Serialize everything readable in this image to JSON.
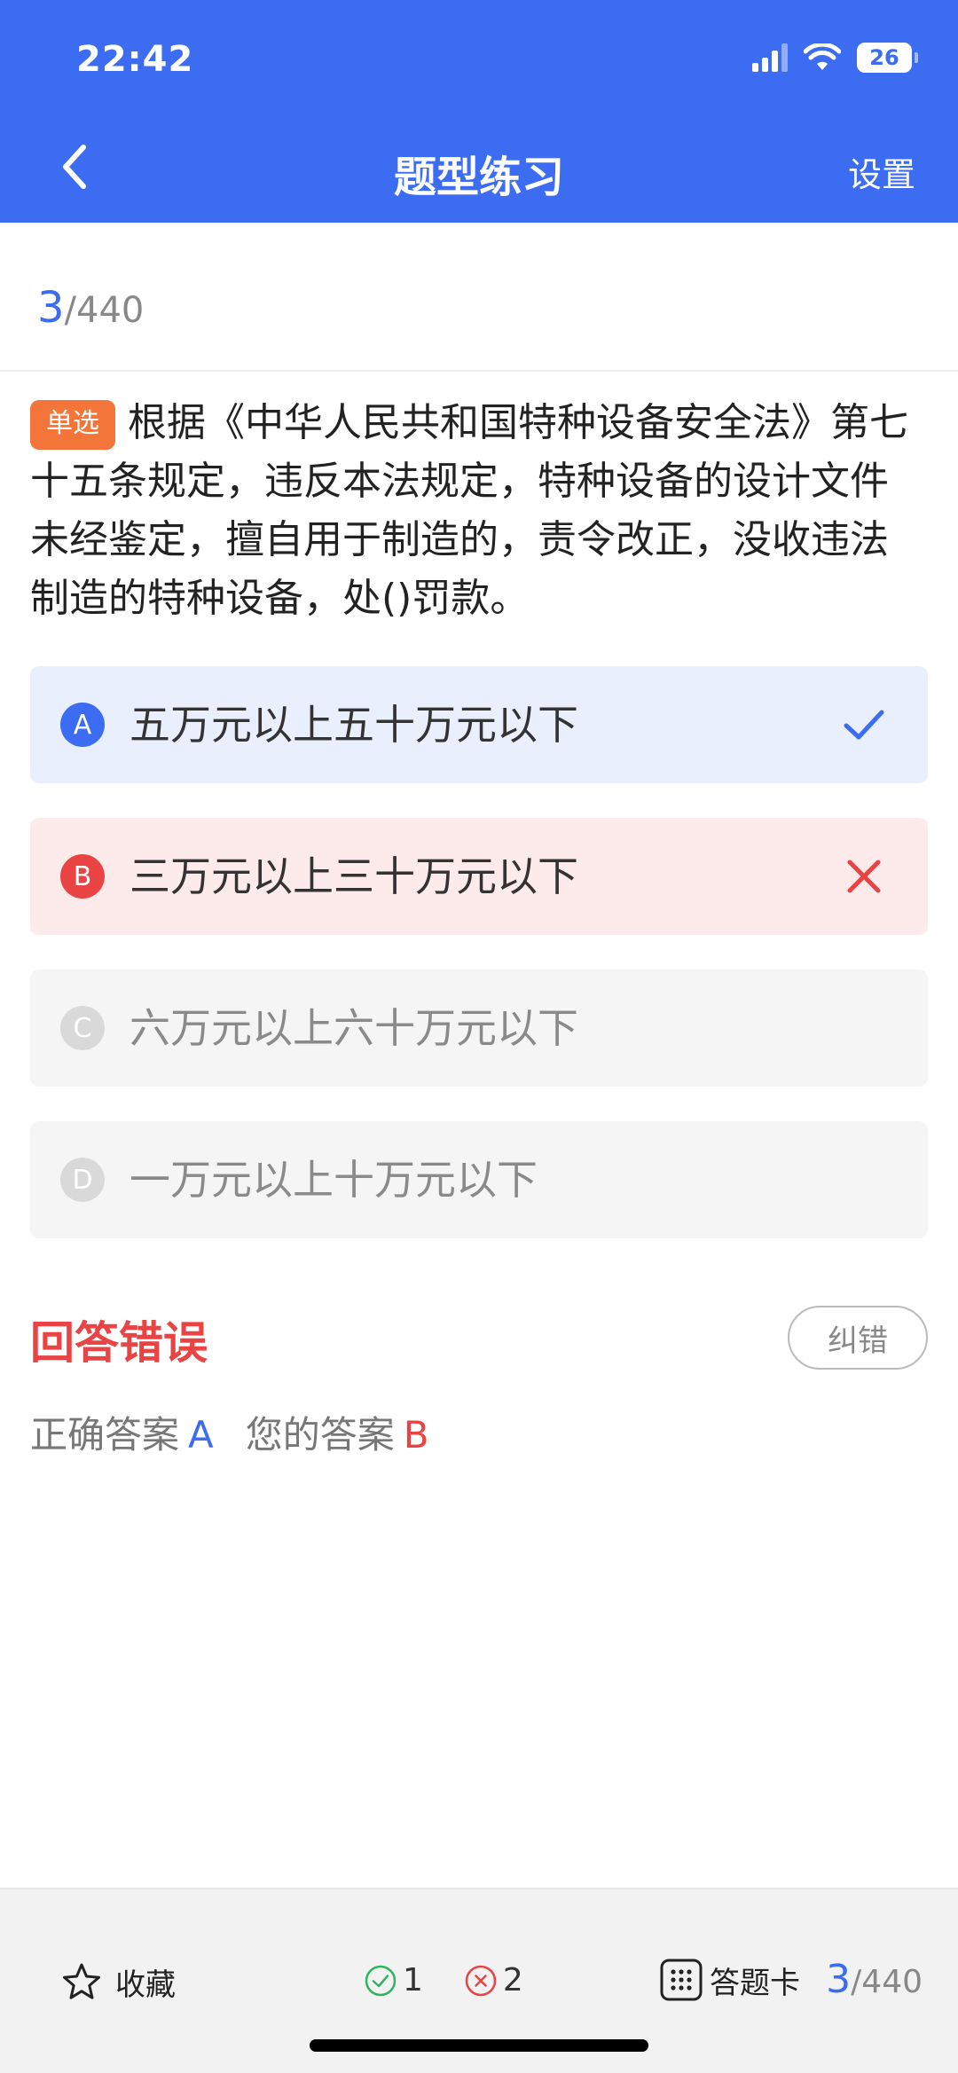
{
  "status_bar": {
    "time": "22:42",
    "battery": "26"
  },
  "nav": {
    "title": "题型练习",
    "settings_label": "设置"
  },
  "progress": {
    "current": "3",
    "total": "/440"
  },
  "question": {
    "type_tag": "单选",
    "text": "根据《中华人民共和国特种设备安全法》第七十五条规定，违反本法规定，特种设备的设计文件未经鉴定，擅自用于制造的，责令改正，没收违法制造的特种设备，处()罚款。"
  },
  "options": [
    {
      "letter": "A",
      "text": "五万元以上五十万元以下",
      "state": "correct"
    },
    {
      "letter": "B",
      "text": "三万元以上三十万元以下",
      "state": "wrong"
    },
    {
      "letter": "C",
      "text": "六万元以上六十万元以下",
      "state": "none"
    },
    {
      "letter": "D",
      "text": "一万元以上十万元以下",
      "state": "none"
    }
  ],
  "result": {
    "title": "回答错误",
    "report_error_label": "纠错",
    "correct_answer_label": "正确答案",
    "correct_answer": "A",
    "your_answer_label": "您的答案",
    "your_answer": "B"
  },
  "bottom_bar": {
    "favorite_label": "收藏",
    "right_count": "1",
    "wrong_count": "2",
    "answer_card_label": "答题卡",
    "current": "3",
    "total": "/440"
  },
  "colors": {
    "primary": "#3b6cf1",
    "error": "#ea4343",
    "tag": "#f4753a",
    "success": "#2fb560"
  },
  "icons": [
    "back-chevron-icon",
    "check-icon",
    "cross-icon",
    "star-icon",
    "check-circle-icon",
    "cross-circle-icon",
    "grid-icon"
  ]
}
